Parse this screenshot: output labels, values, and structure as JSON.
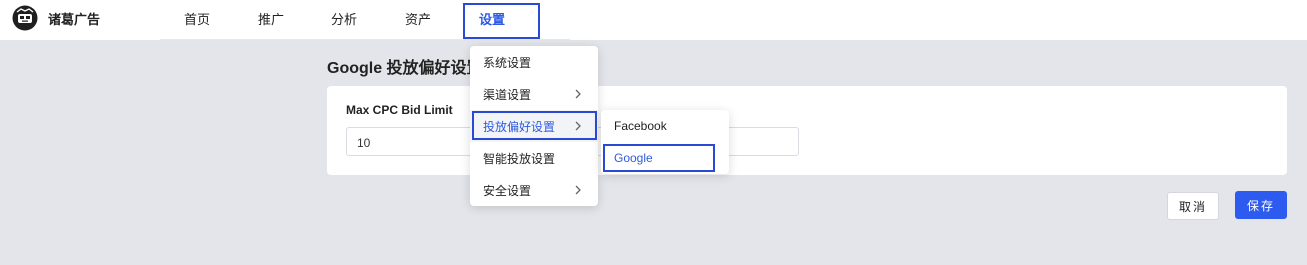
{
  "brand": {
    "name": "诸葛广告"
  },
  "nav": {
    "items": [
      {
        "label": "首页"
      },
      {
        "label": "推广"
      },
      {
        "label": "分析"
      },
      {
        "label": "资产"
      },
      {
        "label": "设置"
      }
    ],
    "active": "设置"
  },
  "page": {
    "title": "Google 投放偏好设置"
  },
  "form": {
    "field_label": "Max CPC Bid Limit",
    "field_value": "10"
  },
  "buttons": {
    "cancel": "取消",
    "save": "保存"
  },
  "menu": {
    "items": [
      {
        "label": "系统设置",
        "has_submenu": false
      },
      {
        "label": "渠道设置",
        "has_submenu": true
      },
      {
        "label": "投放偏好设置",
        "has_submenu": true
      },
      {
        "label": "智能投放设置",
        "has_submenu": false
      },
      {
        "label": "安全设置",
        "has_submenu": true
      }
    ],
    "active": "投放偏好设置"
  },
  "submenu": {
    "items": [
      {
        "label": "Facebook"
      },
      {
        "label": "Google"
      }
    ],
    "active": "Google"
  },
  "colors": {
    "accent": "#2d5be3",
    "primary_button": "#2d5bf0",
    "highlight_box": "#2b4ad4",
    "page_background": "#e3e5ea"
  }
}
